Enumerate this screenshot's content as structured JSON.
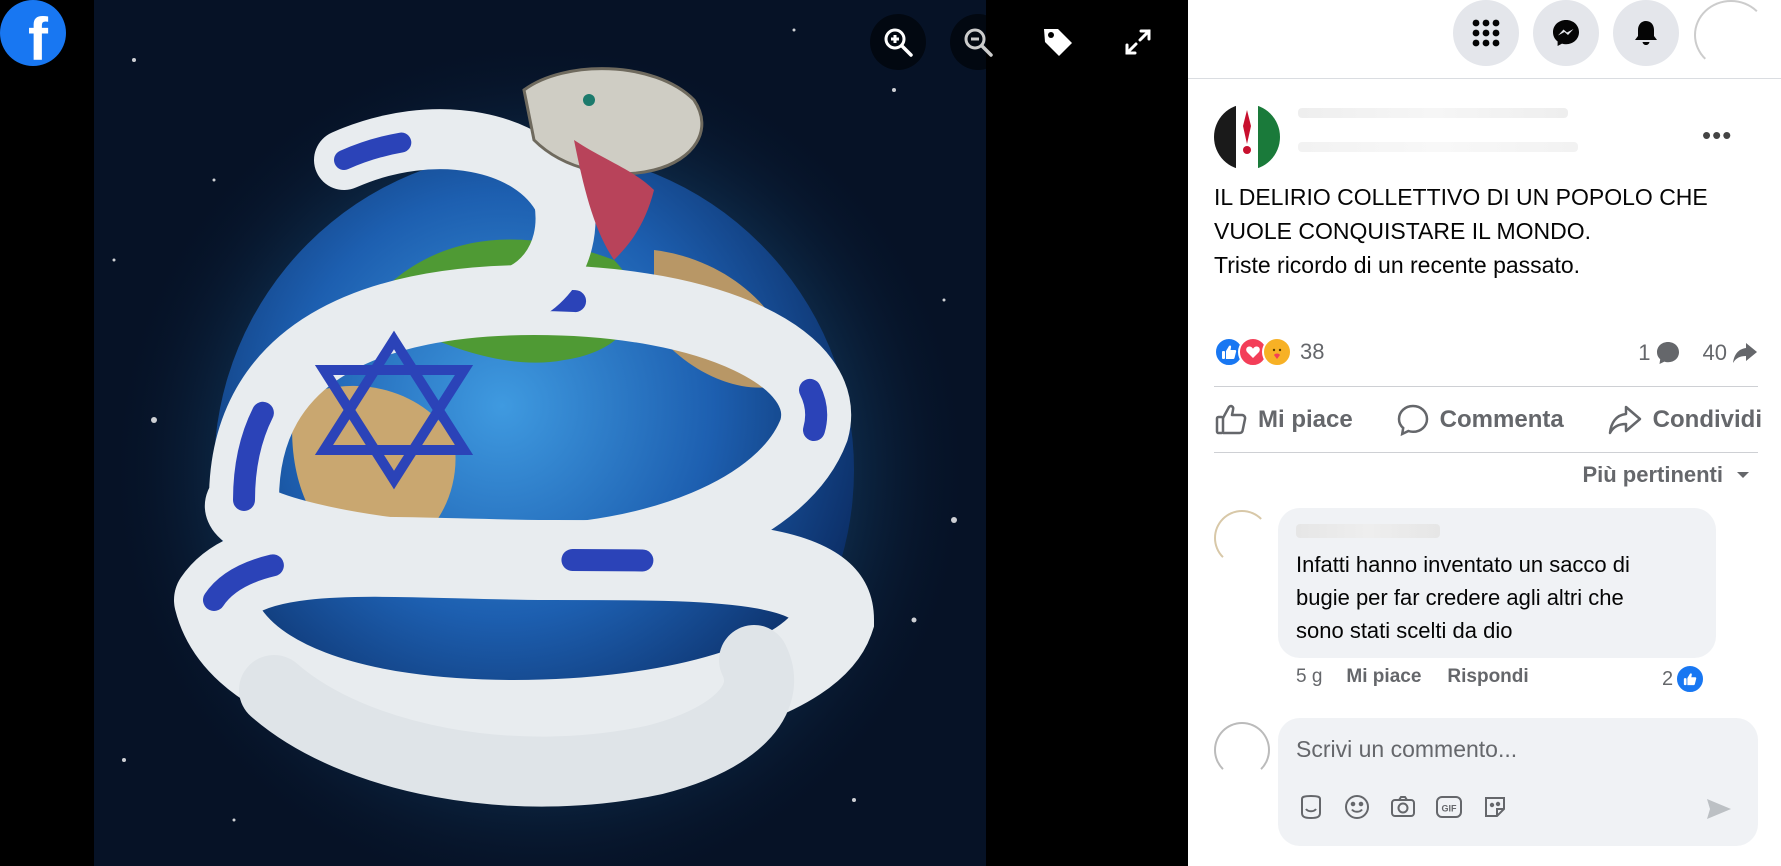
{
  "brand": {
    "name": "facebook",
    "logo_letter": "f",
    "color": "#1877f2"
  },
  "viewer": {
    "tools": [
      {
        "name": "zoom-in-icon"
      },
      {
        "name": "zoom-out-icon"
      },
      {
        "name": "tag-icon"
      },
      {
        "name": "fullscreen-icon"
      }
    ]
  },
  "topbar": {
    "buttons": [
      {
        "name": "menu-grid-icon"
      },
      {
        "name": "messenger-icon"
      },
      {
        "name": "notifications-bell-icon"
      }
    ]
  },
  "post": {
    "text_lines": [
      "IL DELIRIO COLLETTIVO DI UN POPOLO CHE",
      "VUOLE CONQUISTARE IL MONDO.",
      "Triste ricordo di un recente passato."
    ],
    "reaction_count": "38",
    "comments_count": "1",
    "shares_count": "40",
    "actions": {
      "like": "Mi piace",
      "comment": "Commenta",
      "share": "Condividi"
    },
    "sort_label": "Più pertinenti"
  },
  "comment": {
    "lines": [
      "Infatti hanno inventato un sacco di",
      "bugie per far credere agli altri che",
      "sono stati scelti da dio"
    ],
    "time": "5 g",
    "like_label": "Mi piace",
    "reply_label": "Rispondi",
    "likes": "2"
  },
  "composer": {
    "placeholder": "Scrivi un commento...",
    "tools": [
      "avatar-sticker-icon",
      "emoji-icon",
      "camera-icon",
      "gif-icon",
      "sticker-icon"
    ]
  },
  "colors": {
    "accent": "#1877f2",
    "love": "#f33e58",
    "care": "#f7b125",
    "muted": "#65676b"
  }
}
